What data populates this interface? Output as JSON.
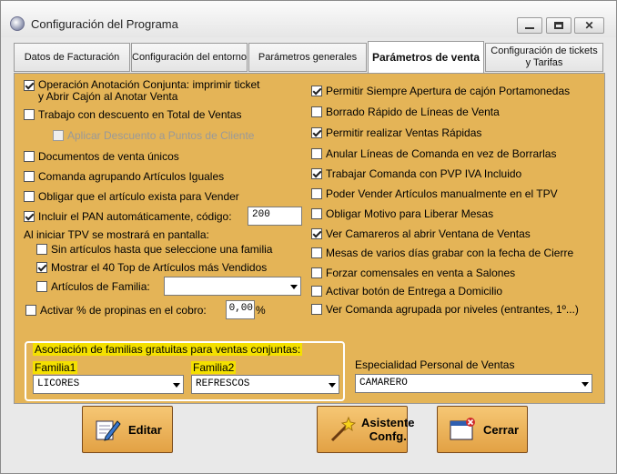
{
  "window": {
    "title": "Configuración del Programa"
  },
  "tabs": [
    {
      "label": "Datos de Facturación"
    },
    {
      "label": "Configuración del entorno"
    },
    {
      "label": "Parámetros generales"
    },
    {
      "label": "Parámetros de venta"
    },
    {
      "label": "Configuración de tickets y Tarifas"
    }
  ],
  "left": {
    "op_conjunta": "Operación Anotación Conjunta: imprimir ticket",
    "op_conjunta2": "y Abrir Cajón al Anotar Venta",
    "trabajo_desc": "Trabajo con descuento en Total de Ventas",
    "aplicar_desc": "Aplicar Descuento a Puntos de Cliente",
    "docs_unicos": "Documentos de venta únicos",
    "comanda_agr": "Comanda agrupando Artículos Iguales",
    "obligar_art": "Obligar que el artículo exista para Vender",
    "incluir_pan": "Incluir el PAN automáticamente, código:",
    "pan_code": "200",
    "al_iniciar": "Al iniciar TPV se mostrará en pantalla:",
    "sin_art": "Sin artículos hasta que seleccione una familia",
    "mostrar_top": "Mostrar el 40 Top de Artículos más Vendidos",
    "art_familia": "Artículos de Familia:",
    "art_familia_value": "",
    "propinas": "Activar % de propinas en el cobro:",
    "propinas_value": "0,00",
    "propinas_unit": "%"
  },
  "right": {
    "r1": "Permitir Siempre Apertura de cajón Portamonedas",
    "r2": "Borrado Rápido de Líneas de Venta",
    "r3": "Permitir realizar Ventas Rápidas",
    "r4": "Anular Líneas de Comanda en vez de Borrarlas",
    "r5": "Trabajar Comanda con PVP IVA Incluido",
    "r6": "Poder Vender Artículos manualmente en el TPV",
    "r7": "Obligar Motivo para Liberar Mesas",
    "r8": "Ver Camareros al abrir Ventana de Ventas",
    "r9": "Mesas de varios días grabar con la fecha de Cierre",
    "r10": "Forzar comensales en venta a Salones",
    "r11": "Activar botón de Entrega a Domicilio",
    "r12": "Ver Comanda agrupada por niveles (entrantes, 1º...)"
  },
  "familias": {
    "title": "Asociación de familias gratuitas para ventas conjuntas:",
    "f1_label": "Familia1",
    "f1_value": "LICORES",
    "f2_label": "Familia2",
    "f2_value": "REFRESCOS"
  },
  "especialidad": {
    "label": "Especialidad Personal de Ventas",
    "value": "CAMARERO"
  },
  "buttons": {
    "editar": "Editar",
    "asistente1": "Asistente",
    "asistente2": "Confg.",
    "cerrar": "Cerrar"
  }
}
